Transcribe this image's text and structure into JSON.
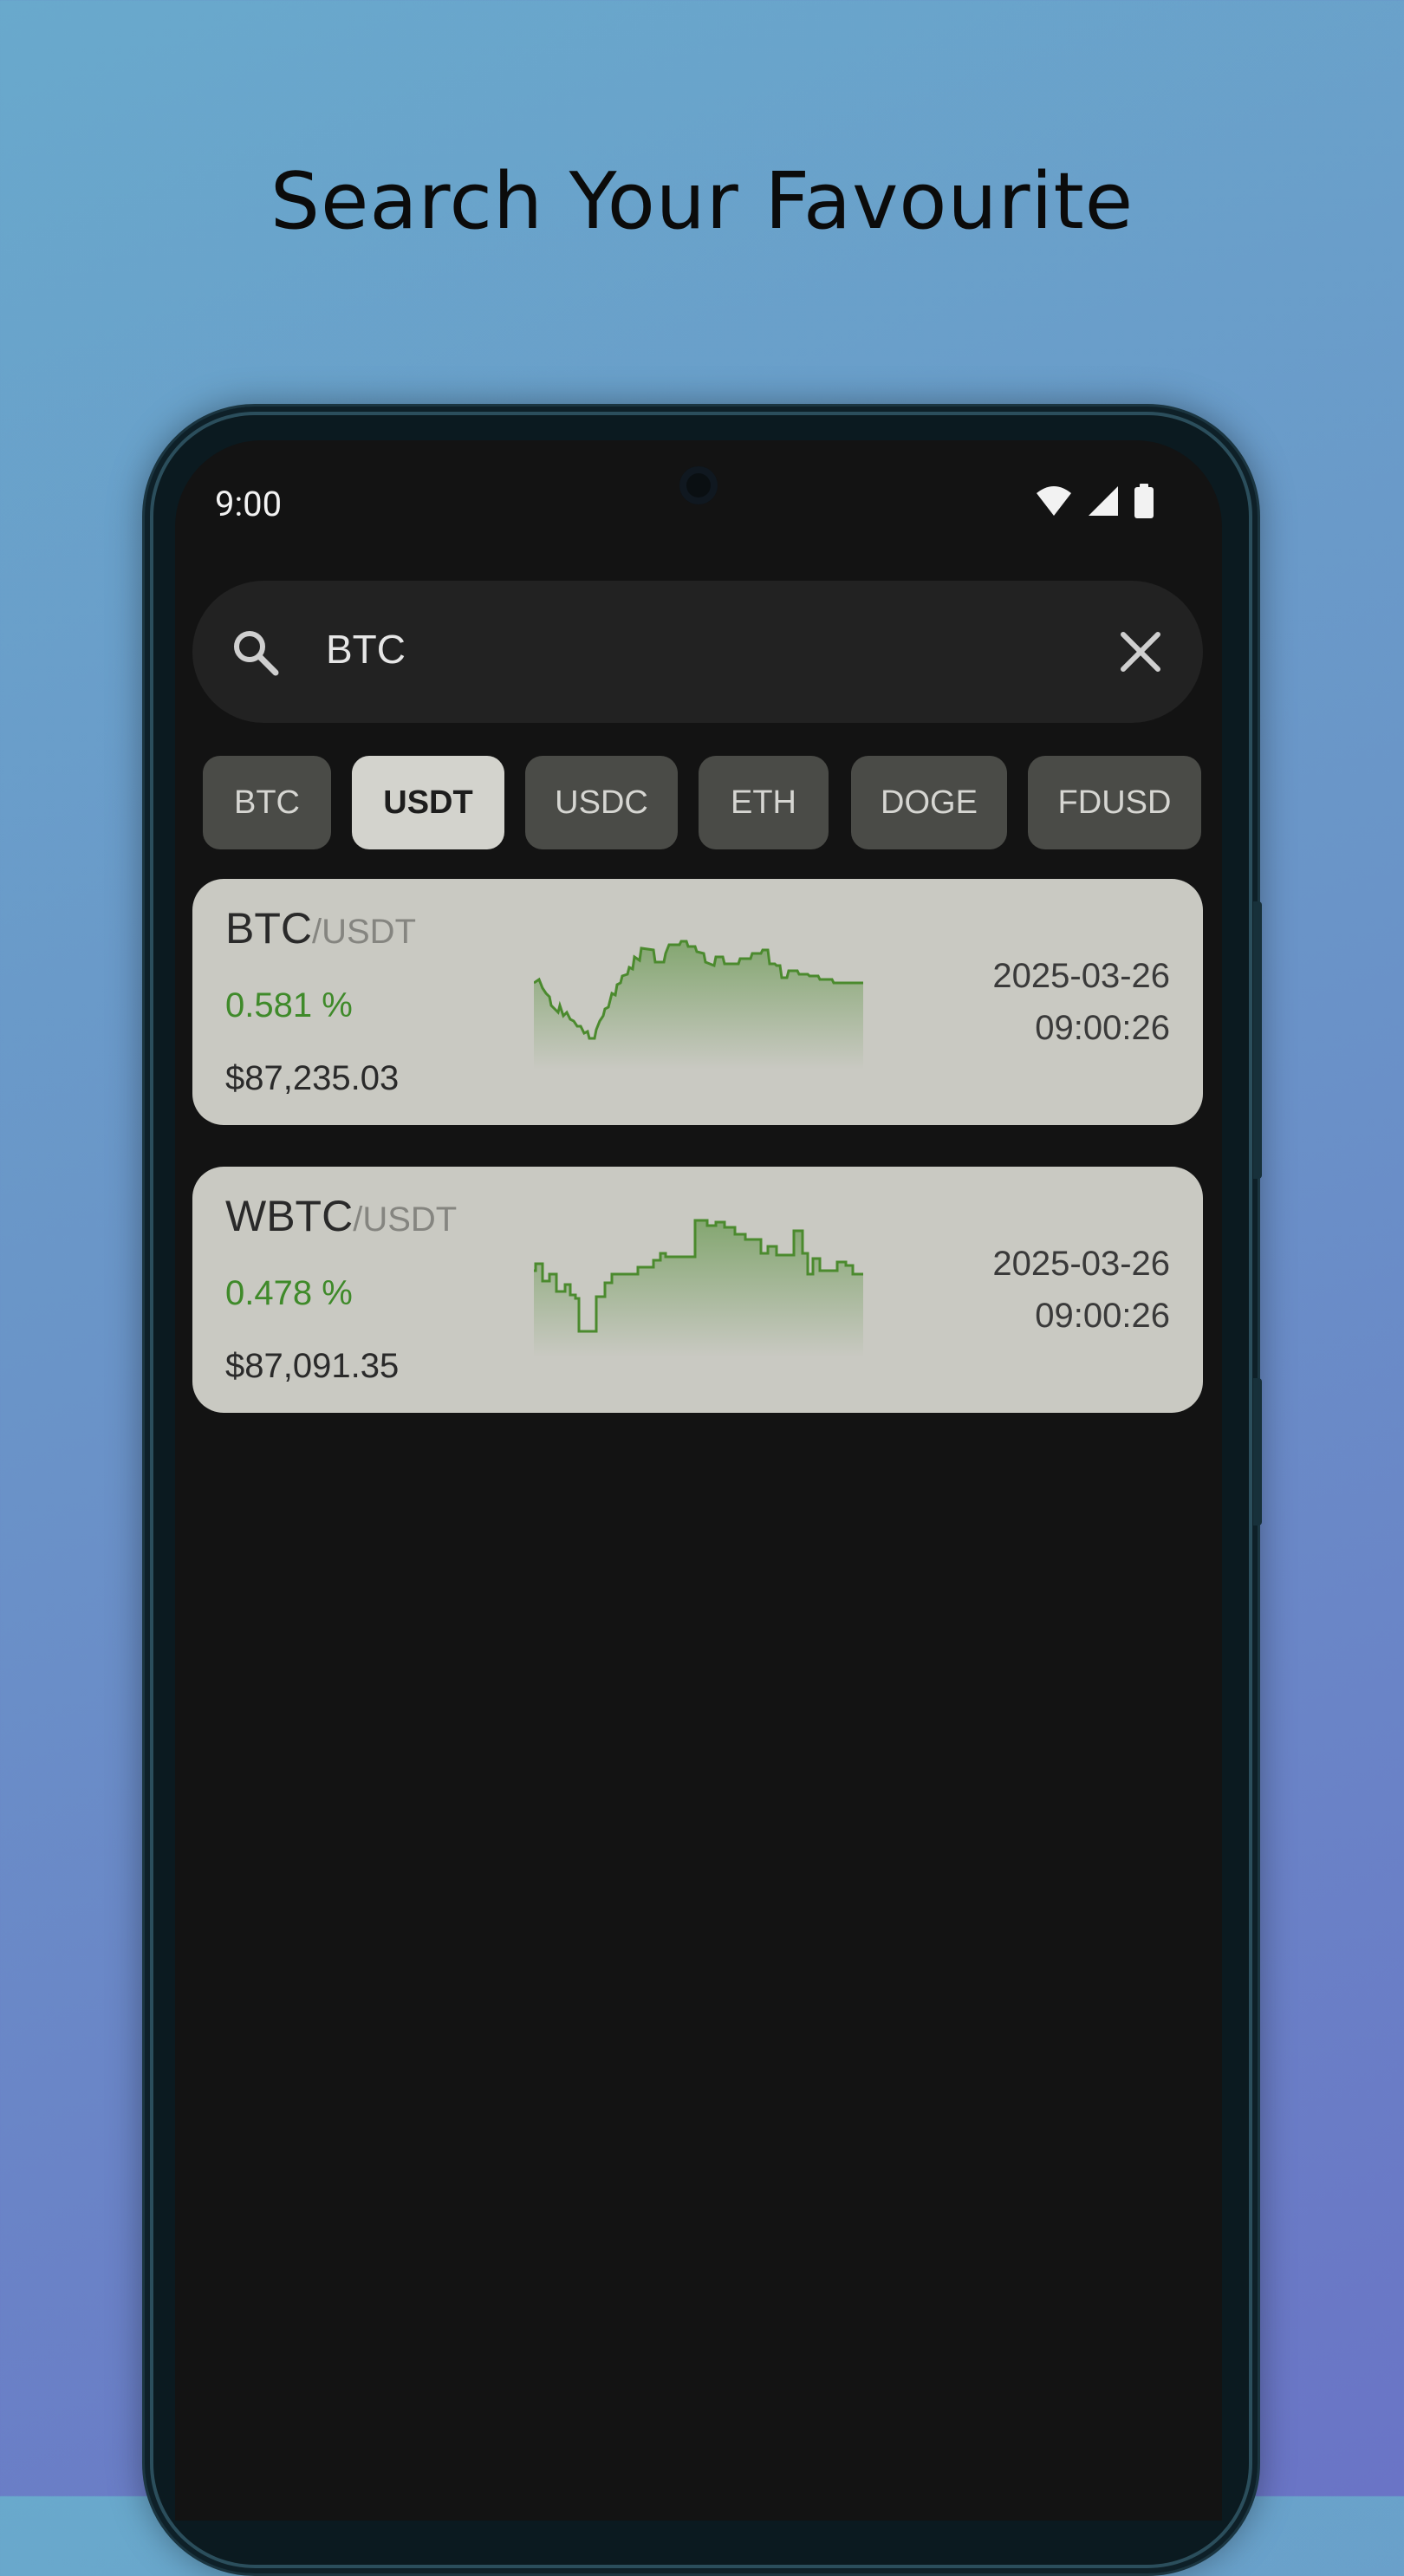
{
  "headline": "Search Your Favourite",
  "status_bar": {
    "time": "9:00"
  },
  "search": {
    "query": "BTC"
  },
  "chips": [
    {
      "label": "BTC",
      "active": false
    },
    {
      "label": "USDT",
      "active": true
    },
    {
      "label": "USDC",
      "active": false
    },
    {
      "label": "ETH",
      "active": false
    },
    {
      "label": "DOGE",
      "active": false
    },
    {
      "label": "FDUSD",
      "active": false
    }
  ],
  "results": [
    {
      "base": "BTC",
      "quote": "/USDT",
      "change": "0.581 %",
      "price": "$87,235.03",
      "date": "2025-03-26",
      "time": "09:00:26"
    },
    {
      "base": "WBTC",
      "quote": "/USDT",
      "change": "0.478 %",
      "price": "$87,091.35",
      "date": "2025-03-26",
      "time": "09:00:26"
    }
  ],
  "colors": {
    "positive": "#3f8a2a",
    "sparkline": "#4b8a2e"
  }
}
